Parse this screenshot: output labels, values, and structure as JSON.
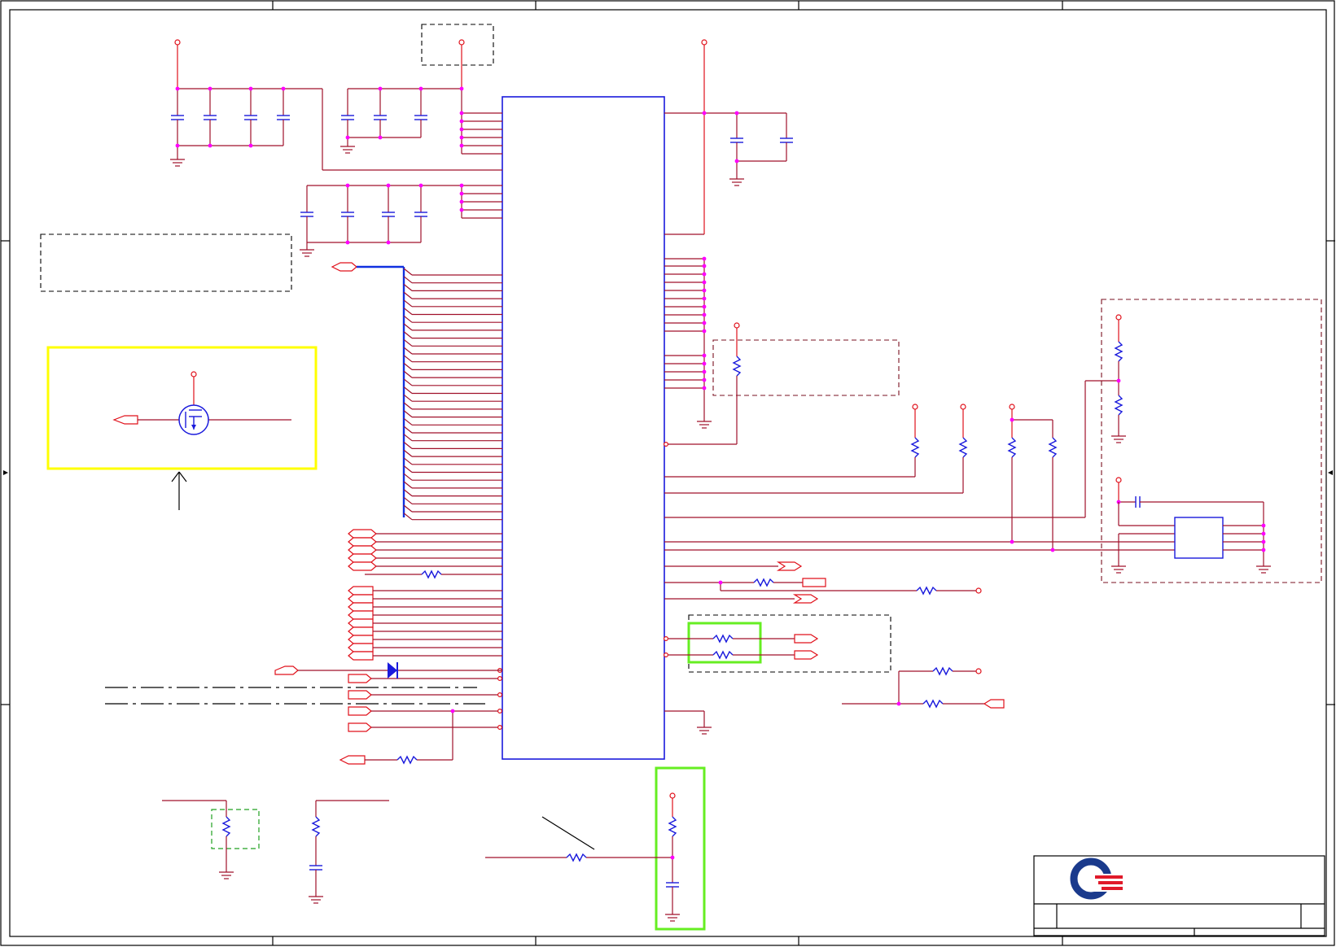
{
  "schematic": {
    "left_bus_net_count": 32,
    "right_pin_count_upper": 16,
    "logo": {
      "colors": {
        "primary": "#1a3a8c",
        "secondary": "#e01a2a"
      }
    }
  },
  "colors": {
    "wire": "#a0102a",
    "component": "#1a1adc",
    "junction": "#ff00ff",
    "highlight_yellow": "#ffff00",
    "highlight_green": "#66ee22"
  }
}
